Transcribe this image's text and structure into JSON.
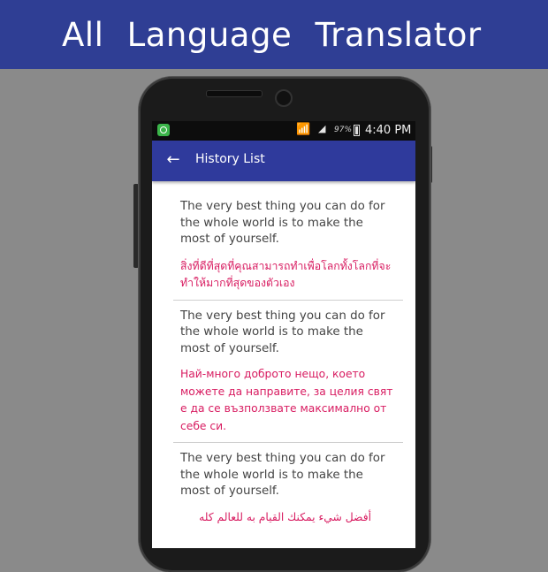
{
  "banner": {
    "title": "All Language Translator"
  },
  "status_bar": {
    "battery": "97%",
    "time": "4:40 PM"
  },
  "app_bar": {
    "title": "History List"
  },
  "history": [
    {
      "source": "The very best thing you can do for the whole world is to make the most of yourself.",
      "translation": "สิ่งที่ดีที่สุดที่คุณสามารถทำเพื่อโลกทั้งโลกที่จะทำให้มากที่สุดของตัวเอง"
    },
    {
      "source": "The very best thing you can do for the whole world is to make the most of yourself.",
      "translation": "Най-много доброто нещо, което можете да направите, за целия свят е да се възползвате максимално от себе си."
    },
    {
      "source": "The very best thing you can do for the whole world is to make the most of yourself.",
      "translation": "أفضل شيء يمكنك القيام به للعالم كله"
    }
  ],
  "colors": {
    "banner": "#2f3e94",
    "app_bar": "#2f3a9c",
    "translation_text": "#d81b60",
    "background": "#8a8a8a"
  },
  "icons": [
    "back-arrow-icon",
    "wifi-icon",
    "signal-icon",
    "battery-icon",
    "app-notification-icon"
  ]
}
